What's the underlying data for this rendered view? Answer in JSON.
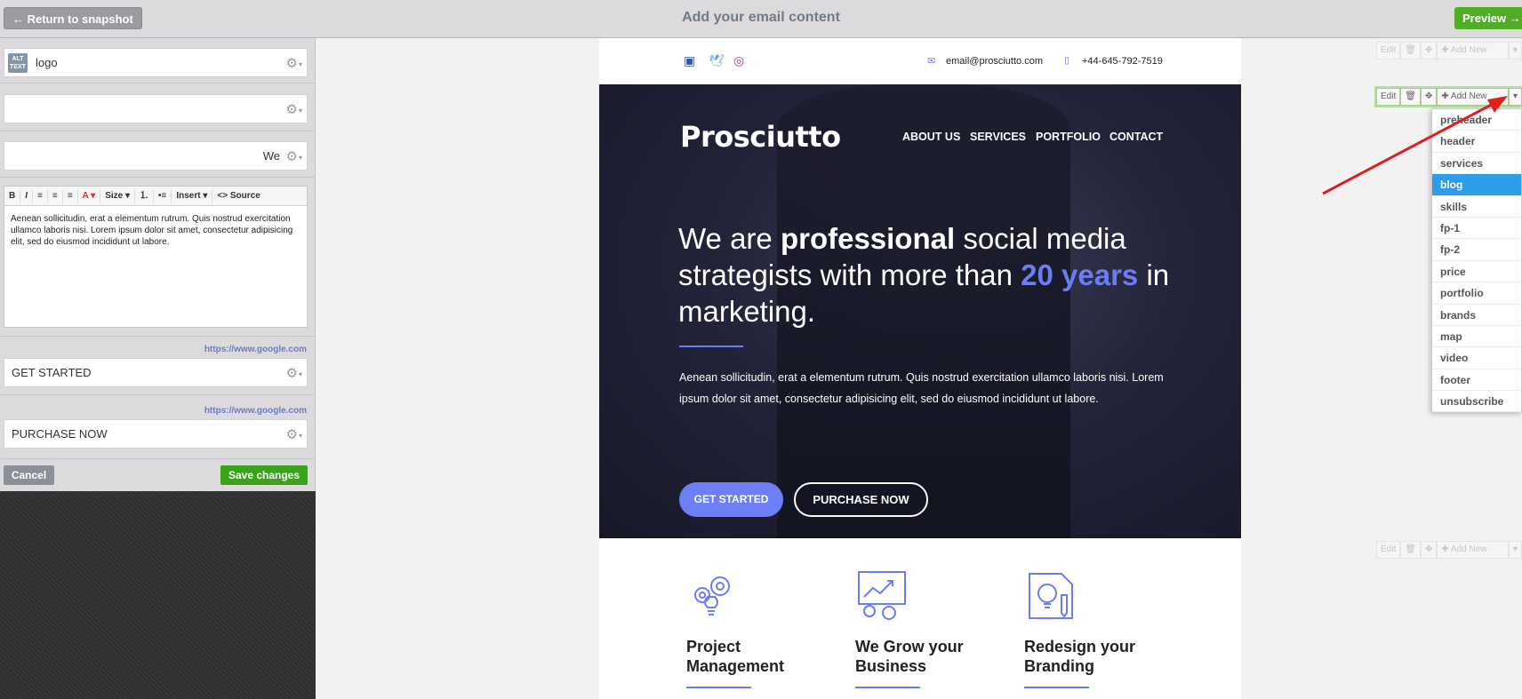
{
  "topbar": {
    "return_label": "← Return to snapshot",
    "title": "Add your email content",
    "preview_label": "Preview →"
  },
  "left_panel": {
    "alt_badge": "ALT TEXT",
    "logo_field": "logo",
    "field2": "",
    "field3": "We",
    "toolbar": {
      "bold": "B",
      "italic": "I",
      "size": "Size ▾",
      "insert": "Insert ▾",
      "source": "<> Source",
      "font_color": "A ▾"
    },
    "editor_text": "Aenean sollicitudin, erat a elementum rutrum. Quis nostrud exercitation ullamco laboris nisi. Lorem ipsum dolor sit amet, consectetur adipisicing elit, sed do eiusmod incididunt ut labore.",
    "url1": "https://www.google.com",
    "button1_field": "GET STARTED",
    "url2": "https://www.google.com",
    "button2_field": "PURCHASE NOW",
    "cancel_label": "Cancel",
    "save_label": "Save changes"
  },
  "email": {
    "preheader": {
      "email": "email@prosciutto.com",
      "phone": "+44-645-792-7519"
    },
    "hero": {
      "brand": "Prosciutto",
      "nav": [
        "ABOUT US",
        "SERVICES",
        "PORTFOLIO",
        "CONTACT"
      ],
      "headline_1": "We are ",
      "headline_bold": "professional",
      "headline_2": " social media strategists with more than ",
      "headline_accent": "20 years",
      "headline_3": " in marketing.",
      "body": "Aenean sollicitudin, erat a elementum rutrum. Quis nostrud exercitation ullamco laboris nisi. Lorem ipsum dolor sit amet, consectetur adipisicing elit, sed do eiusmod incididunt ut labore.",
      "button1": "GET STARTED",
      "button2": "PURCHASE NOW"
    },
    "features": [
      {
        "line1": "Project",
        "line2": "Management"
      },
      {
        "line1": "We Grow your",
        "line2": "Business"
      },
      {
        "line1": "Redesign your",
        "line2": "Branding"
      }
    ]
  },
  "block_controls": {
    "edit": "Edit",
    "add_new": "✚ Add New"
  },
  "dropdown": {
    "items": [
      "preheader",
      "header",
      "services",
      "blog",
      "skills",
      "fp-1",
      "fp-2",
      "price",
      "portfolio",
      "brands",
      "map",
      "video",
      "footer",
      "unsubscribe"
    ],
    "selected": "blog"
  },
  "colors": {
    "accent": "#6b7df0",
    "preview_green": "#4fae23",
    "save_green": "#37a41a",
    "dropdown_selected": "#2e9ce6",
    "annotation_arrow": "#e0201e"
  }
}
